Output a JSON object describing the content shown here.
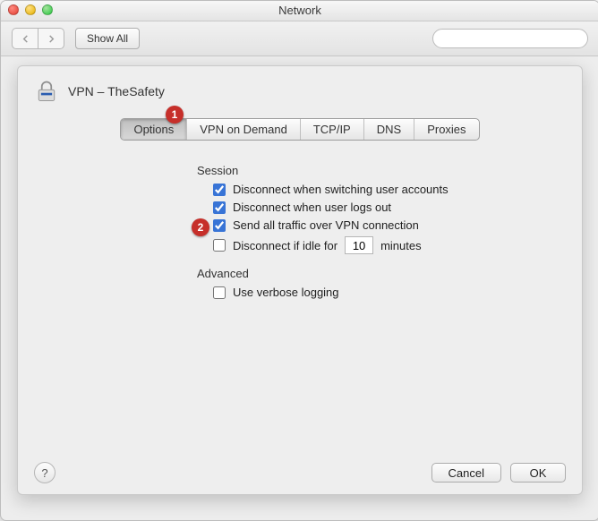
{
  "window": {
    "title": "Network"
  },
  "toolbar": {
    "show_all": "Show All",
    "search_placeholder": ""
  },
  "markers": {
    "one": "1",
    "two": "2"
  },
  "sheet": {
    "title": "VPN – TheSafety",
    "tabs": {
      "options": "Options",
      "vpn_on_demand": "VPN on Demand",
      "tcpip": "TCP/IP",
      "dns": "DNS",
      "proxies": "Proxies"
    },
    "session": {
      "heading": "Session",
      "disconnect_switch_users": "Disconnect when switching user accounts",
      "disconnect_logout": "Disconnect when user logs out",
      "send_all_traffic": "Send all traffic over VPN connection",
      "disconnect_idle_prefix": "Disconnect if idle for",
      "disconnect_idle_value": "10",
      "disconnect_idle_suffix": "minutes"
    },
    "advanced": {
      "heading": "Advanced",
      "verbose_logging": "Use verbose logging"
    },
    "buttons": {
      "cancel": "Cancel",
      "ok": "OK",
      "help": "?"
    }
  }
}
